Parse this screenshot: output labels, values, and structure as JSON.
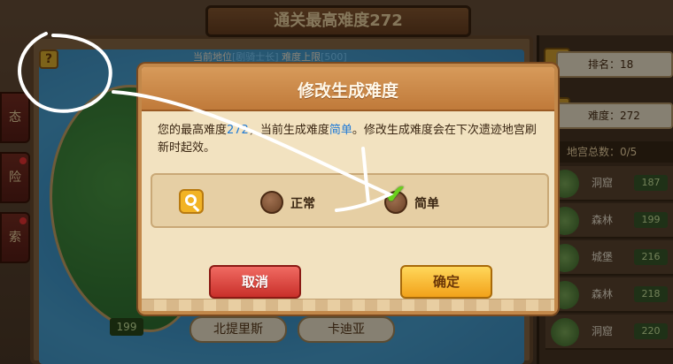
{
  "background": {
    "top_title": "通关最高难度272",
    "current_location_label": "当前地位",
    "current_location_value": "[剧骑士长]",
    "difficulty_cap_label": "难度上限",
    "difficulty_cap_value": "[500]",
    "help_icon_text": "?",
    "left_tabs": [
      "态",
      "险",
      "索"
    ],
    "region_tabs": [
      "北提里斯",
      "卡迪亚"
    ],
    "map_level_badge": "199",
    "rank_text": "排名：18",
    "difficulty_text": "难度：272",
    "dungeon_total": "地宫总数：0/5",
    "dungeons": [
      {
        "name": "洞窟",
        "level": "187"
      },
      {
        "name": "森林",
        "level": "199"
      },
      {
        "name": "城堡",
        "level": "216"
      },
      {
        "name": "森林",
        "level": "218"
      },
      {
        "name": "洞窟",
        "level": "220"
      }
    ]
  },
  "dialog": {
    "title": "修改生成难度",
    "text_part1": "您的最高难度",
    "text_max": "272",
    "text_part2": "，当前生成难度",
    "text_easy": "简单",
    "text_part3": "。修改生成难度会在下次遗迹地宫刷新时起效。",
    "option_normal": "正常",
    "option_easy": "简单",
    "selected": "简单",
    "cancel_label": "取消",
    "ok_label": "确定"
  },
  "colors": {
    "ok_button": "#f2a21a",
    "cancel_button": "#c9302a",
    "highlight_text": "#1f7ad6",
    "check": "#6ad11c"
  },
  "icons": {
    "search": "search-icon",
    "check": "checkmark-icon",
    "help": "help-icon"
  }
}
